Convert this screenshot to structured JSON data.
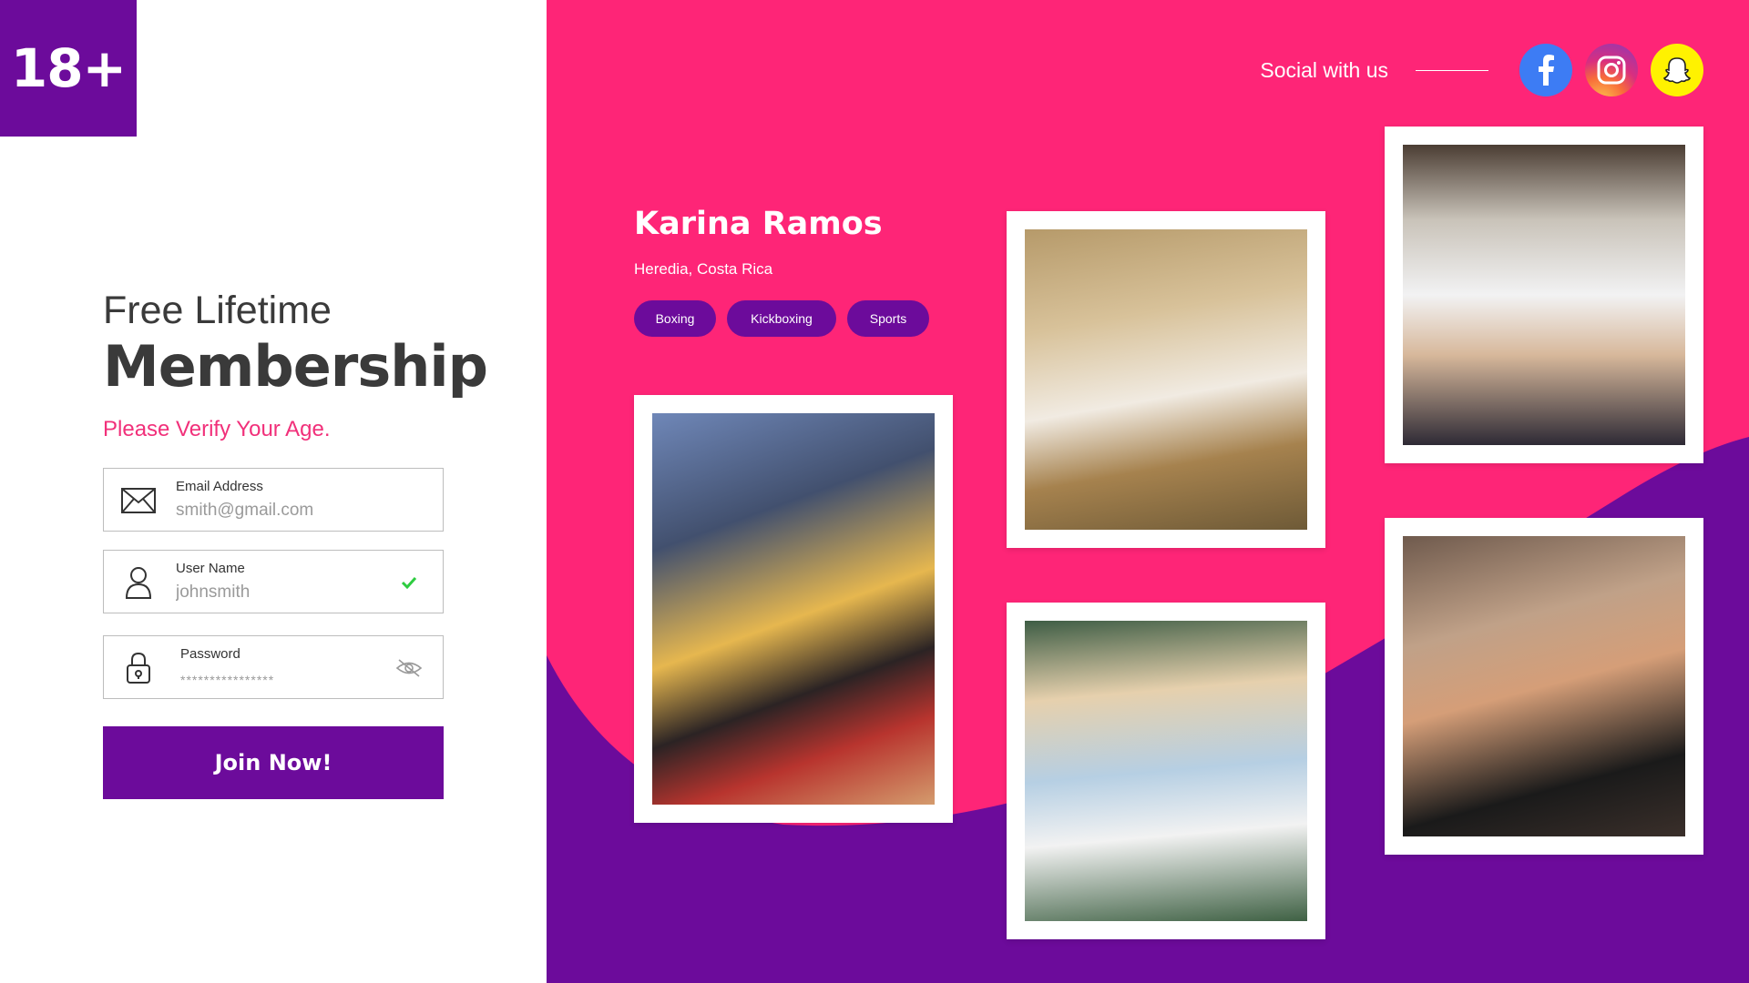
{
  "badge": {
    "text": "18+"
  },
  "membership": {
    "title_light": "Free Lifetime",
    "title_bold": "Membership",
    "subtitle": "Please Verify Your Age."
  },
  "form": {
    "email": {
      "label": "Email Address",
      "value": "smith@gmail.com",
      "icon": "envelope-icon"
    },
    "username": {
      "label": "User Name",
      "value": "johnsmith",
      "icon": "user-icon",
      "status_icon": "checkmark-icon"
    },
    "password": {
      "label": "Password",
      "value": "****************",
      "icon": "lock-icon",
      "toggle_icon": "eye-slash-icon"
    },
    "submit_label": "Join Now!"
  },
  "social": {
    "label": "Social with us",
    "links": [
      {
        "name": "facebook",
        "icon": "facebook-icon",
        "color": "#3d7cf4"
      },
      {
        "name": "instagram",
        "icon": "instagram-icon",
        "color": "#d92e7f"
      },
      {
        "name": "snapchat",
        "icon": "snapchat-icon",
        "color": "#fff200"
      }
    ]
  },
  "profile": {
    "name": "Karina Ramos",
    "location": "Heredia, Costa Rica",
    "tags": [
      "Boxing",
      "Kickboxing",
      "Sports"
    ]
  },
  "gallery": {
    "photos": [
      "photo-1",
      "photo-2",
      "photo-3",
      "photo-4",
      "photo-5"
    ]
  },
  "colors": {
    "purple": "#6c0b9b",
    "pink": "#fe2577",
    "accent_text": "#f1307a",
    "check_green": "#2ecc40"
  }
}
